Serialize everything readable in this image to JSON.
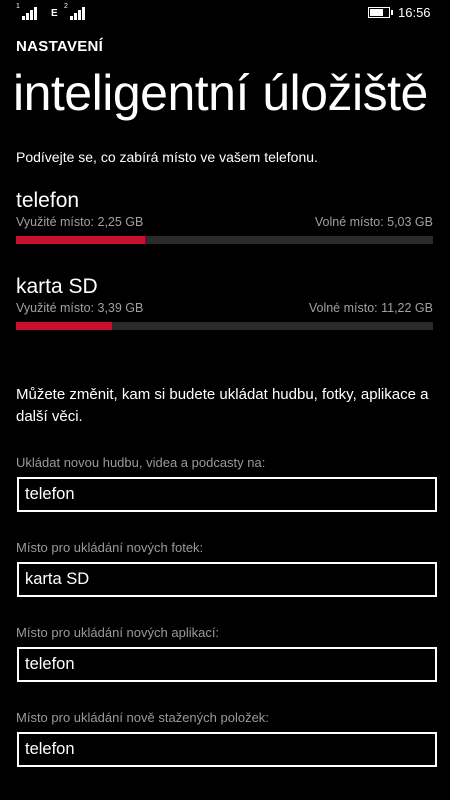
{
  "status_bar": {
    "sim1_label": "1",
    "network": "E",
    "sim2_label": "2",
    "battery_level": 0.8,
    "time": "16:56"
  },
  "header": {
    "section": "NASTAVENÍ",
    "title": "inteligentní úložiště"
  },
  "intro_text": "Podívejte se, co zabírá místo ve vašem telefonu.",
  "storage": [
    {
      "name": "telefon",
      "used_label": "Využité místo: 2,25 GB",
      "free_label": "Volné místo: 5,03 GB",
      "used_fraction": 0.31
    },
    {
      "name": "karta SD",
      "used_label": "Využité místo: 3,39 GB",
      "free_label": "Volné místo: 11,22 GB",
      "used_fraction": 0.23
    }
  ],
  "change_text": "Můžete změnit, kam si budete ukládat hudbu, fotky, aplikace a další věci.",
  "settings": [
    {
      "label": "Ukládat novou hudbu, videa a podcasty na:",
      "value": "telefon"
    },
    {
      "label": "Místo pro ukládání nových fotek:",
      "value": "karta SD"
    },
    {
      "label": "Místo pro ukládání nových aplikací:",
      "value": "telefon"
    },
    {
      "label": "Místo pro ukládání nově stažených položek:",
      "value": "telefon"
    }
  ]
}
